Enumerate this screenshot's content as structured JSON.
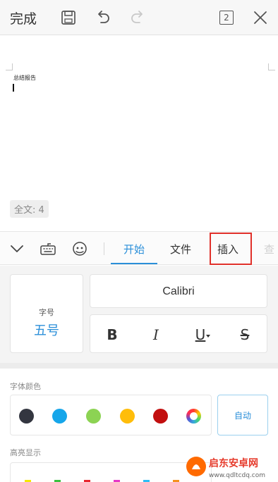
{
  "toolbar": {
    "done_label": "完成",
    "page_count": "2",
    "icons": [
      "save-icon",
      "undo-icon",
      "redo-icon",
      "page-count-icon",
      "close-icon"
    ]
  },
  "document": {
    "title_text": "总结报告",
    "word_count": "全文: 4"
  },
  "tabs": {
    "icons": [
      "collapse-chevron-icon",
      "keyboard-icon",
      "emoji-icon"
    ],
    "items": [
      "开始",
      "文件",
      "插入",
      "查"
    ],
    "active": "开始",
    "active_color": "#2b8fd9"
  },
  "font_panel": {
    "size_label": "字号",
    "size_value": "五号",
    "font_name": "Calibri",
    "format_buttons": [
      "B",
      "I",
      "U",
      "S"
    ]
  },
  "font_color": {
    "label": "字体颜色",
    "swatches": [
      "#333640",
      "#16a6ea",
      "#8cd353",
      "#ffbd0a",
      "#c20f0f",
      "rainbow"
    ],
    "auto_label": "自动"
  },
  "highlight": {
    "label": "高亮显示",
    "colors": [
      "#f5e800",
      "#39c23f",
      "#e8262f",
      "#e637c7",
      "#2fbdf5",
      "#f5901f",
      "#b23fe0"
    ]
  },
  "annotation": {
    "highlight_color": "#e0302a"
  },
  "watermark": {
    "name": "启东安卓网",
    "url": "www.qdltcdq.com"
  }
}
